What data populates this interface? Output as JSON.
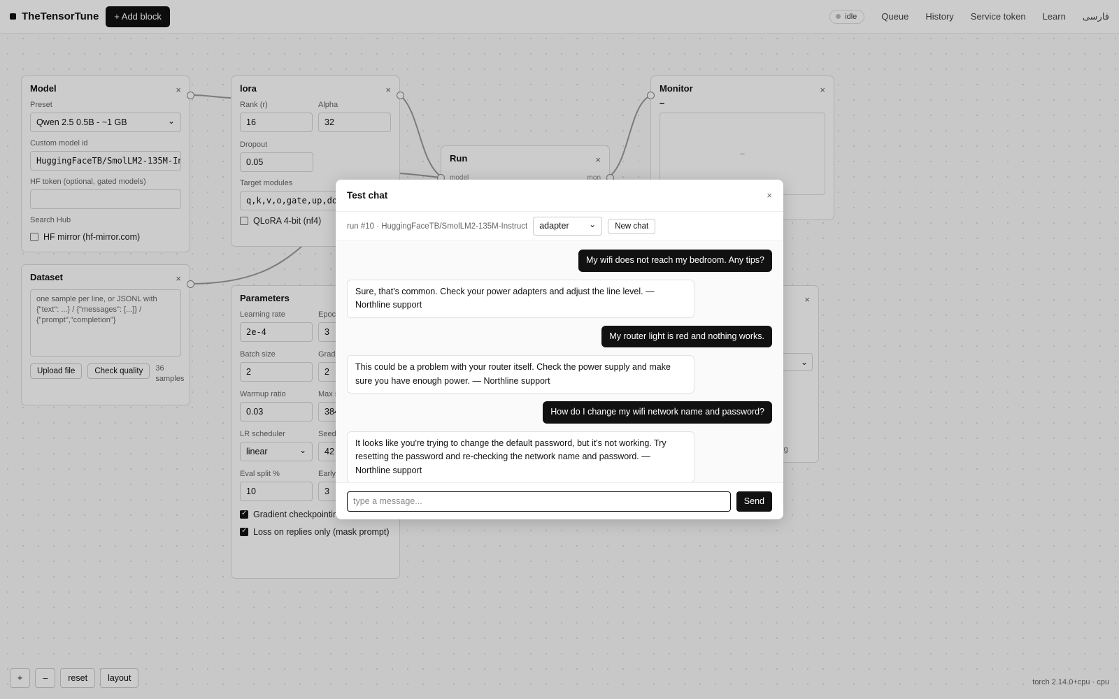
{
  "app": {
    "brand": "TheTensorTune",
    "add_block_label": "+ Add block",
    "status": "idle",
    "nav": [
      "Queue",
      "History",
      "Service token",
      "Learn",
      "فارسی"
    ],
    "version": "torch 2.14.0+cpu · cpu"
  },
  "close_glyph": "×",
  "blocks": {
    "model": {
      "title": "Model",
      "preset_label": "Preset",
      "preset_value": "Qwen 2.5 0.5B - ~1 GB",
      "custom_label": "Custom model id",
      "custom_value": "HuggingFaceTB/SmolLM2-135M-Instruct",
      "hf_token_label": "HF token (optional, gated models)",
      "hf_token_value": "",
      "search_hub_label": "Search Hub",
      "hf_mirror_label": "HF mirror (hf-mirror.com)"
    },
    "lora": {
      "title": "lora",
      "rank_label": "Rank (r)",
      "rank_value": "16",
      "alpha_label": "Alpha",
      "alpha_value": "32",
      "dropout_label": "Dropout",
      "dropout_value": "0.05",
      "target_label": "Target modules",
      "target_value": "q,k,v,o,gate,up,down",
      "qlora_label": "QLoRA 4-bit (nf4)"
    },
    "dataset": {
      "title": "Dataset",
      "placeholder": "one sample per line, or JSONL with {\"text\": ...} / {\"messages\": [...]} / {\"prompt\",\"completion\"}",
      "upload_label": "Upload file",
      "check_label": "Check quality",
      "count": "36 samples"
    },
    "parameters": {
      "title": "Parameters",
      "lr_label": "Learning rate",
      "lr_value": "2e-4",
      "epochs_label": "Epochs",
      "epochs_value": "3",
      "batch_label": "Batch size",
      "batch_value": "2",
      "grad_label": "Grad accum",
      "grad_value": "2",
      "warmup_label": "Warmup ratio",
      "warmup_value": "0.03",
      "maxseq_label": "Max seq",
      "maxseq_value": "384",
      "sched_label": "LR scheduler",
      "sched_value": "linear",
      "seed_label": "Seed",
      "seed_value": "42",
      "eval_label": "Eval split %",
      "eval_value": "10",
      "early_label": "Early stop",
      "early_value": "3",
      "grad_ckpt_label": "Gradient checkpointing",
      "loss_label": "Loss on replies only (mask prompt)"
    },
    "run": {
      "title": "Run",
      "port_model": "model",
      "port_mon": "mon"
    },
    "monitor": {
      "title": "Monitor",
      "value": "–",
      "chart_placeholder": "–"
    },
    "hidden_block": {
      "partial_text": "ning"
    }
  },
  "chat": {
    "title": "Test chat",
    "run_info": "run #10 · HuggingFaceTB/SmolLM2-135M-Instruct",
    "mode": "adapter",
    "new_chat_label": "New chat",
    "messages": [
      {
        "role": "user",
        "text": "My wifi does not reach my bedroom. Any tips?"
      },
      {
        "role": "assistant",
        "text": "Sure, that's common. Check your power adapters and adjust the line level. — Northline support"
      },
      {
        "role": "user",
        "text": "My router light is red and nothing works."
      },
      {
        "role": "assistant",
        "text": "This could be a problem with your router itself. Check the power supply and make sure you have enough power. — Northline support"
      },
      {
        "role": "user",
        "text": "How do I change my wifi network name and password?"
      },
      {
        "role": "assistant",
        "text": "It looks like you're trying to change the default password, but it's not working. Try resetting the password and re-checking the network name and password. — Northline support"
      }
    ],
    "input_placeholder": "type a message...",
    "send_label": "Send"
  },
  "controls": {
    "zoom_in": "+",
    "zoom_out": "–",
    "reset": "reset",
    "layout": "layout"
  }
}
